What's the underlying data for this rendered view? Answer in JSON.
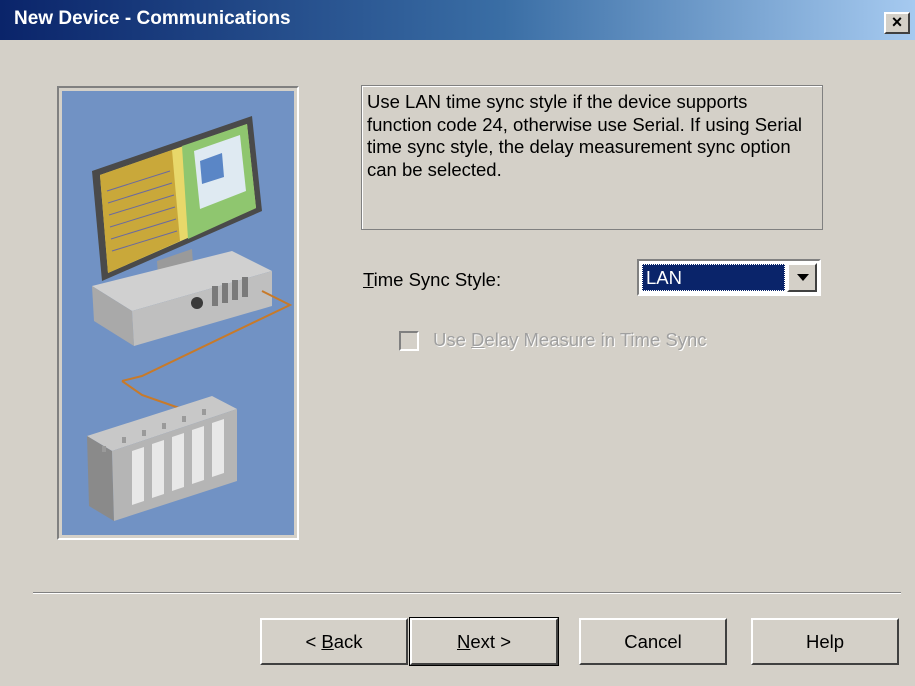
{
  "window": {
    "title": "New Device - Communications",
    "close_glyph": "×"
  },
  "illustration": {
    "icon": "computer-and-plc-illustration"
  },
  "description": "Use LAN time sync style if the device supports function code 24, otherwise use Serial. If using Serial time sync style, the delay measurement sync option can be selected.",
  "time_sync": {
    "label_mnemonic": "T",
    "label_rest": "ime Sync Style:",
    "selected": "LAN"
  },
  "delay_option": {
    "label_pre": "Use ",
    "label_mnemonic": "D",
    "label_rest": "elay Measure in Time Sync",
    "checked": false,
    "enabled": false
  },
  "buttons": {
    "back_pre": "< ",
    "back_mnemonic": "B",
    "back_rest": "ack",
    "next_mnemonic": "N",
    "next_rest": "ext >",
    "cancel": "Cancel",
    "help": "Help"
  },
  "colors": {
    "title_start": "#0a246a",
    "title_end": "#a6caf0",
    "face": "#d4d0c8",
    "selection": "#0a246a",
    "illustration_bg": "#7192c4"
  }
}
